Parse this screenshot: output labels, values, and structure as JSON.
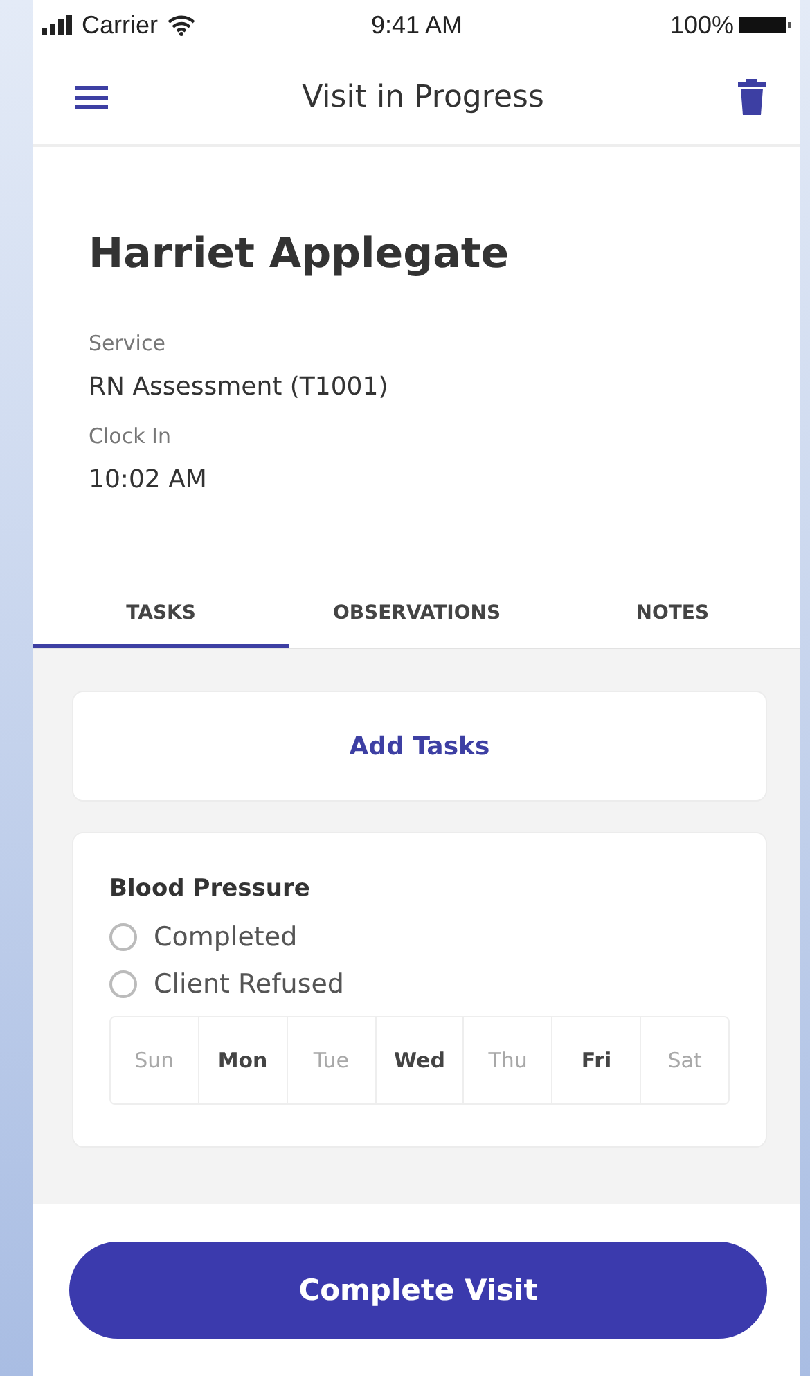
{
  "status_bar": {
    "carrier": "Carrier",
    "time": "9:41 AM",
    "battery": "100%"
  },
  "header": {
    "title": "Visit in Progress"
  },
  "client": {
    "name": "Harriet Applegate"
  },
  "fields": [
    {
      "label": "Service",
      "value": "RN Assessment (T1001)"
    },
    {
      "label": "Clock In",
      "value": "10:02 AM"
    }
  ],
  "tabs": [
    {
      "label": "TASKS",
      "selected": true
    },
    {
      "label": "OBSERVATIONS",
      "selected": false
    },
    {
      "label": "NOTES",
      "selected": false
    }
  ],
  "add_tasks": "Add Tasks",
  "task": {
    "title": "Blood Pressure",
    "options": [
      {
        "label": "Completed",
        "checked": false
      },
      {
        "label": "Client Refused",
        "checked": false
      }
    ],
    "days": [
      {
        "label": "Sun",
        "selected": false
      },
      {
        "label": "Mon",
        "selected": true
      },
      {
        "label": "Tue",
        "selected": false
      },
      {
        "label": "Wed",
        "selected": true
      },
      {
        "label": "Thu",
        "selected": false
      },
      {
        "label": "Fri",
        "selected": true
      },
      {
        "label": "Sat",
        "selected": false
      }
    ]
  },
  "complete_button": "Complete Visit"
}
